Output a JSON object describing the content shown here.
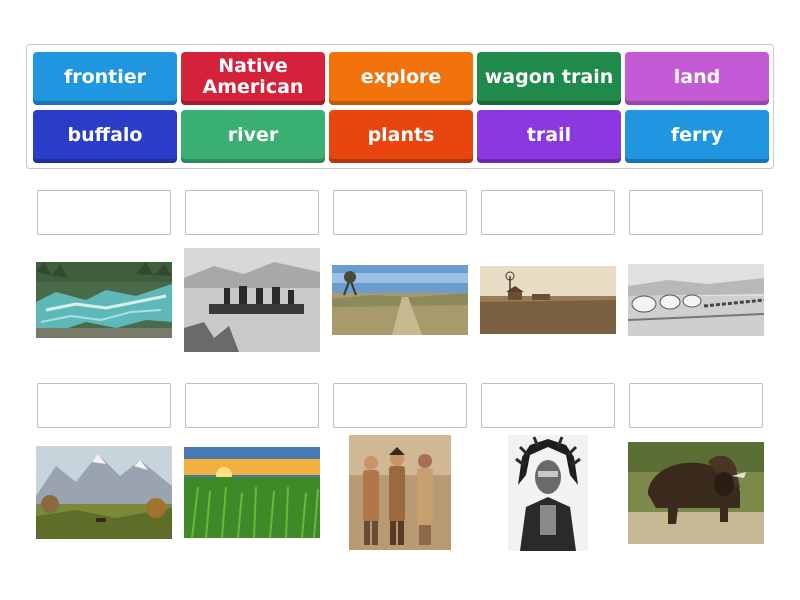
{
  "tiles": [
    {
      "label": "frontier",
      "color": "#2196e0"
    },
    {
      "label": "Native\nAmerican",
      "color": "#d3223a"
    },
    {
      "label": "explore",
      "color": "#f2720c"
    },
    {
      "label": "wagon train",
      "color": "#1f8a4a"
    },
    {
      "label": "land",
      "color": "#c45ad6"
    },
    {
      "label": "buffalo",
      "color": "#2a3dc9"
    },
    {
      "label": "river",
      "color": "#3aaf72"
    },
    {
      "label": "plants",
      "color": "#e8460e"
    },
    {
      "label": "trail",
      "color": "#8a38e0"
    },
    {
      "label": "ferry",
      "color": "#2196e0"
    }
  ],
  "images": [
    {
      "name": "river-image",
      "icon": "river-stream-picture"
    },
    {
      "name": "ferry-image",
      "icon": "ferry-raft-picture"
    },
    {
      "name": "trail-image",
      "icon": "dirt-trail-picture"
    },
    {
      "name": "frontier-image",
      "icon": "homestead-frontier-picture"
    },
    {
      "name": "wagon-train-image",
      "icon": "covered-wagons-picture"
    },
    {
      "name": "land-image",
      "icon": "mountain-landscape-picture"
    },
    {
      "name": "plants-image",
      "icon": "corn-field-picture"
    },
    {
      "name": "explore-image",
      "icon": "explorers-picture"
    },
    {
      "name": "native-american-image",
      "icon": "chief-portrait-picture"
    },
    {
      "name": "buffalo-image",
      "icon": "bison-picture"
    }
  ]
}
